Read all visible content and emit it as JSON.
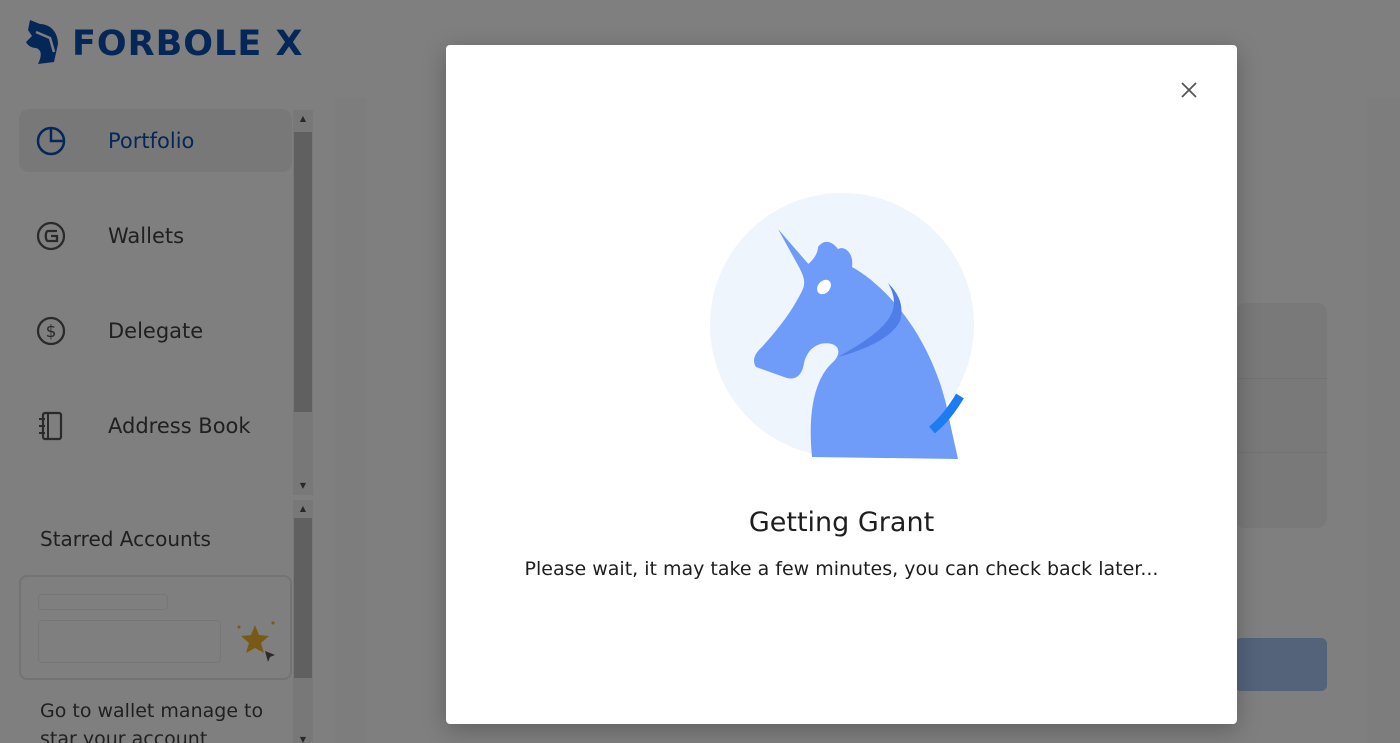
{
  "app": {
    "brand_name": "FORBOLE X",
    "brand_color": "#0a4fae"
  },
  "sidebar": {
    "items": [
      {
        "label": "Portfolio",
        "icon": "pie-chart-icon",
        "active": true
      },
      {
        "label": "Wallets",
        "icon": "wallet-icon",
        "active": false
      },
      {
        "label": "Delegate",
        "icon": "dollar-circle-icon",
        "active": false
      },
      {
        "label": "Address Book",
        "icon": "address-book-icon",
        "active": false
      }
    ],
    "starred": {
      "title": "Starred Accounts",
      "hint": "Go to wallet manage to star your account"
    }
  },
  "modal": {
    "title": "Getting Grant",
    "message": "Please wait, it may take a few minutes, you can check back later...",
    "illustration": "unicorn-icon",
    "close_icon": "close-icon",
    "accent_color": "#1e7cf2"
  }
}
